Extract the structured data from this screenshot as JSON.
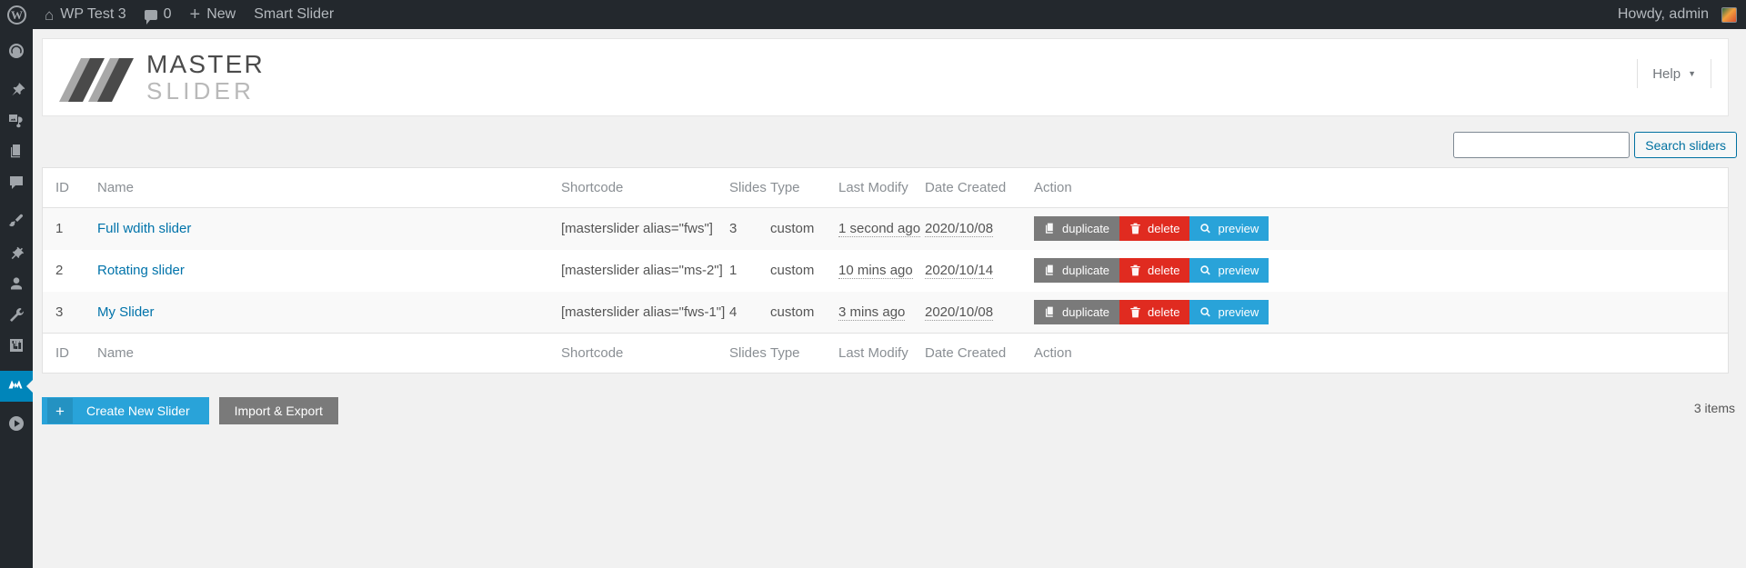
{
  "adminbar": {
    "wp_logo": "wordpress-logo",
    "site_name": "WP Test 3",
    "comment_count": "0",
    "new_label": "New",
    "smart_slider_label": "Smart Slider",
    "howdy": "Howdy, admin"
  },
  "sidebar": {
    "items": [
      {
        "name": "dashboard",
        "icon": "dashboard-icon",
        "current": false
      },
      {
        "name": "posts",
        "icon": "pin-icon",
        "current": false
      },
      {
        "name": "media",
        "icon": "media-icon",
        "current": false
      },
      {
        "name": "pages",
        "icon": "pages-icon",
        "current": false
      },
      {
        "name": "comments",
        "icon": "comment-icon",
        "current": false
      },
      {
        "name": "appearance",
        "icon": "brush-icon",
        "current": false
      },
      {
        "name": "plugins",
        "icon": "plug-icon",
        "current": false
      },
      {
        "name": "users",
        "icon": "user-icon",
        "current": false
      },
      {
        "name": "tools",
        "icon": "wrench-icon",
        "current": false
      },
      {
        "name": "settings",
        "icon": "sliders-icon",
        "current": false
      },
      {
        "name": "master-slider",
        "icon": "masterslider-m-icon",
        "current": true
      },
      {
        "name": "smart-slider",
        "icon": "play-circle-icon",
        "current": false
      }
    ]
  },
  "header": {
    "logo_master": "MASTER",
    "logo_slider": "SLIDER",
    "help_label": "Help",
    "help_caret": "chevron-down-icon"
  },
  "search": {
    "value": "",
    "placeholder": "",
    "button_label": "Search sliders"
  },
  "table": {
    "columns": [
      "ID",
      "Name",
      "Shortcode",
      "Slides",
      "Type",
      "Last Modify",
      "Date Created",
      "Action"
    ],
    "rows": [
      {
        "id": "1",
        "name": "Full wdith slider",
        "shortcode": "[masterslider alias=\"fws\"]",
        "slides": "3",
        "type": "custom",
        "last_modify": "1 second ago",
        "date_created": "2020/10/08"
      },
      {
        "id": "2",
        "name": "Rotating slider",
        "shortcode": "[masterslider alias=\"ms-2\"]",
        "slides": "1",
        "type": "custom",
        "last_modify": "10 mins ago",
        "date_created": "2020/10/14"
      },
      {
        "id": "3",
        "name": "My Slider",
        "shortcode": "[masterslider alias=\"fws-1\"]",
        "slides": "4",
        "type": "custom",
        "last_modify": "3 mins ago",
        "date_created": "2020/10/08"
      }
    ],
    "actions": {
      "duplicate": "duplicate",
      "delete": "delete",
      "preview": "preview"
    }
  },
  "footer": {
    "create_label": "Create New Slider",
    "create_icon": "plus-icon",
    "import_label": "Import & Export",
    "items_count": "3 items"
  },
  "colors": {
    "accent_blue": "#29a3d9",
    "link_blue": "#0073aa",
    "delete_red": "#e02b20",
    "gray_button": "#7a7a7a",
    "adminbar_bg": "#23282d",
    "current_menu": "#0085ba"
  }
}
